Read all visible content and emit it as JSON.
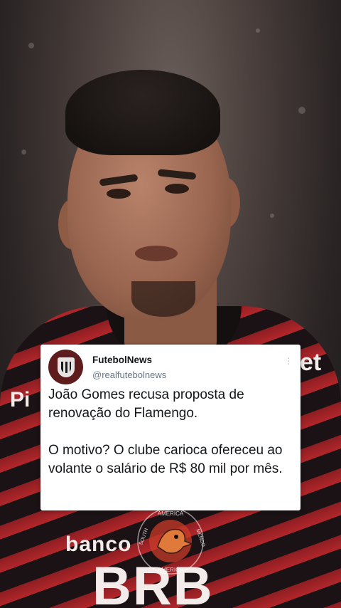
{
  "tweet": {
    "display_name": "FutebolNews",
    "handle": "@realfutebolnews",
    "paragraph_1": "João Gomes recusa proposta de renovação do Flamengo.",
    "paragraph_2": "O motivo? O clube carioca ofereceu ao volante o salário de R$ 80 mil por mês.",
    "avatar_icon": "shield-logo-icon",
    "menu_icon": "more-vertical-icon"
  },
  "background": {
    "jersey_text_left": "Pi",
    "jersey_text_right": "et",
    "jersey_sponsor_1": "banco",
    "jersey_sponsor_2": "BRB",
    "colors": {
      "jersey_red": "#b2262a",
      "jersey_black": "#1a1214"
    }
  },
  "watermark": {
    "text_top": "AMERICA",
    "text_left": "SOUTH",
    "text_right": "MENCO",
    "text_bottom": "AMERICA",
    "icon": "eagle-mascot-icon"
  }
}
